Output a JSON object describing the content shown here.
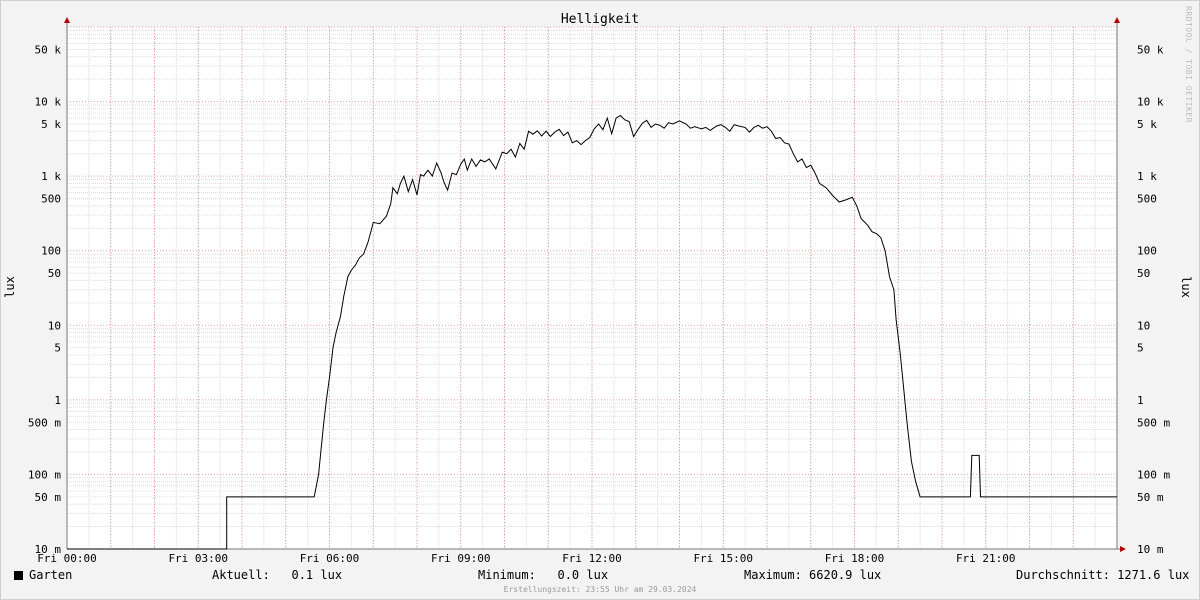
{
  "chart_data": {
    "type": "line",
    "title": "Helligkeit",
    "ylabel": "lux",
    "y_scale": "log",
    "ylim": [
      0.01,
      100000
    ],
    "xlim": [
      0,
      24
    ],
    "grid": true,
    "x_tick_labels": [
      {
        "x": 0,
        "label": "Fri 00:00"
      },
      {
        "x": 3,
        "label": "Fri 03:00"
      },
      {
        "x": 6,
        "label": "Fri 06:00"
      },
      {
        "x": 9,
        "label": "Fri 09:00"
      },
      {
        "x": 12,
        "label": "Fri 12:00"
      },
      {
        "x": 15,
        "label": "Fri 15:00"
      },
      {
        "x": 18,
        "label": "Fri 18:00"
      },
      {
        "x": 21,
        "label": "Fri 21:00"
      }
    ],
    "y_tick_labels": [
      {
        "y": 0.01,
        "label": "10 m"
      },
      {
        "y": 0.05,
        "label": "50 m"
      },
      {
        "y": 0.1,
        "label": "100 m"
      },
      {
        "y": 0.5,
        "label": "500 m"
      },
      {
        "y": 1,
        "label": "1"
      },
      {
        "y": 5,
        "label": "5"
      },
      {
        "y": 10,
        "label": "10"
      },
      {
        "y": 50,
        "label": "50"
      },
      {
        "y": 100,
        "label": "100"
      },
      {
        "y": 500,
        "label": "500"
      },
      {
        "y": 1000,
        "label": "1 k"
      },
      {
        "y": 5000,
        "label": "5 k"
      },
      {
        "y": 10000,
        "label": "10 k"
      },
      {
        "y": 50000,
        "label": "50 k"
      }
    ],
    "series": [
      {
        "name": "Garten",
        "color": "#000000",
        "points": [
          [
            0,
            0.01
          ],
          [
            3.65,
            0.01
          ],
          [
            3.65,
            0.05
          ],
          [
            5.65,
            0.05
          ],
          [
            5.75,
            0.1
          ],
          [
            5.8,
            0.2
          ],
          [
            5.87,
            0.5
          ],
          [
            5.93,
            1
          ],
          [
            6.0,
            2
          ],
          [
            6.08,
            5
          ],
          [
            6.15,
            8
          ],
          [
            6.25,
            13
          ],
          [
            6.33,
            25
          ],
          [
            6.42,
            45
          ],
          [
            6.5,
            55
          ],
          [
            6.6,
            65
          ],
          [
            6.68,
            80
          ],
          [
            6.78,
            90
          ],
          [
            6.88,
            130
          ],
          [
            7.0,
            240
          ],
          [
            7.15,
            230
          ],
          [
            7.3,
            290
          ],
          [
            7.4,
            430
          ],
          [
            7.45,
            700
          ],
          [
            7.55,
            580
          ],
          [
            7.62,
            800
          ],
          [
            7.7,
            1000
          ],
          [
            7.8,
            620
          ],
          [
            7.9,
            900
          ],
          [
            8.0,
            560
          ],
          [
            8.08,
            1050
          ],
          [
            8.15,
            1000
          ],
          [
            8.25,
            1200
          ],
          [
            8.35,
            1000
          ],
          [
            8.45,
            1500
          ],
          [
            8.55,
            1100
          ],
          [
            8.62,
            820
          ],
          [
            8.7,
            650
          ],
          [
            8.8,
            1100
          ],
          [
            8.9,
            1050
          ],
          [
            9.0,
            1450
          ],
          [
            9.08,
            1700
          ],
          [
            9.15,
            1200
          ],
          [
            9.25,
            1700
          ],
          [
            9.35,
            1350
          ],
          [
            9.45,
            1650
          ],
          [
            9.55,
            1550
          ],
          [
            9.65,
            1700
          ],
          [
            9.8,
            1250
          ],
          [
            9.95,
            2100
          ],
          [
            10.05,
            2000
          ],
          [
            10.15,
            2300
          ],
          [
            10.25,
            1800
          ],
          [
            10.35,
            2750
          ],
          [
            10.45,
            2300
          ],
          [
            10.55,
            4000
          ],
          [
            10.65,
            3650
          ],
          [
            10.75,
            4050
          ],
          [
            10.85,
            3450
          ],
          [
            10.95,
            4000
          ],
          [
            11.05,
            3400
          ],
          [
            11.15,
            3900
          ],
          [
            11.25,
            4250
          ],
          [
            11.35,
            3500
          ],
          [
            11.45,
            3900
          ],
          [
            11.55,
            2800
          ],
          [
            11.65,
            3000
          ],
          [
            11.75,
            2650
          ],
          [
            11.85,
            3000
          ],
          [
            11.95,
            3300
          ],
          [
            12.05,
            4300
          ],
          [
            12.15,
            5000
          ],
          [
            12.25,
            4200
          ],
          [
            12.35,
            6000
          ],
          [
            12.45,
            3700
          ],
          [
            12.55,
            6000
          ],
          [
            12.65,
            6500
          ],
          [
            12.75,
            5700
          ],
          [
            12.85,
            5400
          ],
          [
            12.95,
            3400
          ],
          [
            13.05,
            4200
          ],
          [
            13.15,
            5100
          ],
          [
            13.25,
            5600
          ],
          [
            13.35,
            4500
          ],
          [
            13.45,
            5000
          ],
          [
            13.55,
            4800
          ],
          [
            13.65,
            4400
          ],
          [
            13.75,
            5200
          ],
          [
            13.85,
            5000
          ],
          [
            14.0,
            5500
          ],
          [
            14.15,
            5000
          ],
          [
            14.25,
            4400
          ],
          [
            14.35,
            4600
          ],
          [
            14.5,
            4300
          ],
          [
            14.6,
            4500
          ],
          [
            14.7,
            4100
          ],
          [
            14.85,
            4700
          ],
          [
            14.95,
            4900
          ],
          [
            15.05,
            4500
          ],
          [
            15.15,
            4000
          ],
          [
            15.25,
            4900
          ],
          [
            15.35,
            4700
          ],
          [
            15.5,
            4500
          ],
          [
            15.6,
            3900
          ],
          [
            15.7,
            4500
          ],
          [
            15.8,
            4800
          ],
          [
            15.9,
            4400
          ],
          [
            16.0,
            4600
          ],
          [
            16.1,
            4000
          ],
          [
            16.2,
            3200
          ],
          [
            16.3,
            3300
          ],
          [
            16.4,
            2800
          ],
          [
            16.5,
            2700
          ],
          [
            16.6,
            2000
          ],
          [
            16.7,
            1550
          ],
          [
            16.8,
            1700
          ],
          [
            16.9,
            1300
          ],
          [
            17.0,
            1400
          ],
          [
            17.1,
            1100
          ],
          [
            17.2,
            800
          ],
          [
            17.35,
            700
          ],
          [
            17.5,
            550
          ],
          [
            17.65,
            450
          ],
          [
            17.8,
            480
          ],
          [
            17.95,
            520
          ],
          [
            18.05,
            400
          ],
          [
            18.15,
            270
          ],
          [
            18.3,
            220
          ],
          [
            18.4,
            180
          ],
          [
            18.5,
            170
          ],
          [
            18.6,
            150
          ],
          [
            18.7,
            100
          ],
          [
            18.8,
            45
          ],
          [
            18.9,
            30
          ],
          [
            18.95,
            12
          ],
          [
            19.05,
            4
          ],
          [
            19.12,
            1.5
          ],
          [
            19.2,
            0.5
          ],
          [
            19.3,
            0.15
          ],
          [
            19.4,
            0.08
          ],
          [
            19.5,
            0.05
          ],
          [
            20.65,
            0.05
          ],
          [
            20.68,
            0.18
          ],
          [
            20.85,
            0.18
          ],
          [
            20.88,
            0.05
          ],
          [
            24,
            0.05
          ]
        ]
      }
    ]
  },
  "legend": {
    "series_name": "Garten",
    "current_label": "Aktuell:",
    "current_value": "0.1 lux",
    "minimum_label": "Minimum:",
    "minimum_value": "0.0 lux",
    "maximum_label": "Maximum:",
    "maximum_value": "6620.9 lux",
    "average_label": "Durchschnitt:",
    "average_value": "1271.6 lux"
  },
  "footer": "Erstellungszeit: 23:55 Uhr am 29.03.2024",
  "watermark": "RRDTOOL / TOBI OETIKER",
  "colors": {
    "background": "#f3f3f3",
    "canvas": "#ffffff",
    "major_grid": "#e8a0a0",
    "minor_grid": "#dcdcdc",
    "axis_arrow": "#b00000",
    "line": "#000000"
  }
}
